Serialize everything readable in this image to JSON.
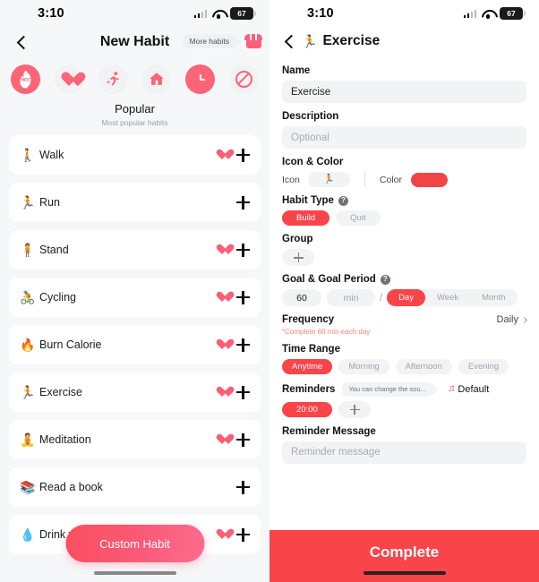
{
  "left": {
    "status": {
      "time": "3:10",
      "battery": "67"
    },
    "nav": {
      "back_icon": "chevron-left-icon",
      "title": "New Habit",
      "tooltip": "More habits",
      "store_icon": "store-icon"
    },
    "categories": [
      {
        "name": "popular",
        "icon": "flame-hot-icon",
        "active": true
      },
      {
        "name": "health",
        "icon": "heart-icon",
        "active": false
      },
      {
        "name": "fitness",
        "icon": "running-icon",
        "glyph": "🏃",
        "active": false
      },
      {
        "name": "home",
        "icon": "house-icon",
        "glyph": "🏠",
        "active": false
      },
      {
        "name": "routine",
        "icon": "clock-icon",
        "active": false
      },
      {
        "name": "quit",
        "icon": "no-entry-icon",
        "active": false
      }
    ],
    "category_title": "Popular",
    "category_subtitle": "Most popular habits",
    "habits": [
      {
        "emoji": "🚶",
        "label": "Walk",
        "favorite": true
      },
      {
        "emoji": "🏃",
        "label": "Run",
        "favorite": false
      },
      {
        "emoji": "🧍",
        "label": "Stand",
        "favorite": true
      },
      {
        "emoji": "🚴",
        "label": "Cycling",
        "favorite": true
      },
      {
        "emoji": "🔥",
        "label": "Burn Calorie",
        "favorite": true
      },
      {
        "emoji": "🏃",
        "label": "Exercise",
        "favorite": true
      },
      {
        "emoji": "🧘",
        "label": "Meditation",
        "favorite": true
      },
      {
        "emoji": "📚",
        "label": "Read a book",
        "favorite": false
      },
      {
        "emoji": "💧",
        "label": "Drink water",
        "favorite": true
      }
    ],
    "custom_habit_button": "Custom Habit"
  },
  "right": {
    "status": {
      "time": "3:10",
      "battery": "67"
    },
    "nav": {
      "back_icon": "chevron-left-icon",
      "emoji": "🏃",
      "title": "Exercise"
    },
    "name": {
      "label": "Name",
      "value": "Exercise"
    },
    "description": {
      "label": "Description",
      "placeholder": "Optional"
    },
    "icon_color": {
      "label": "Icon & Color",
      "icon_label": "Icon",
      "icon_glyph": "🏃",
      "color_label": "Color",
      "color_value": "#f04447"
    },
    "habit_type": {
      "label": "Habit Type",
      "help_icon": "question-mark-icon",
      "options": [
        {
          "label": "Build",
          "selected": true
        },
        {
          "label": "Quit",
          "selected": false
        }
      ]
    },
    "group": {
      "label": "Group",
      "add_icon": "plus-icon"
    },
    "goal": {
      "label": "Goal & Goal Period",
      "help_icon": "question-mark-icon",
      "amount": "60",
      "unit": "min",
      "separator": "/",
      "periods": [
        {
          "label": "Day",
          "selected": true
        },
        {
          "label": "Week",
          "selected": false
        },
        {
          "label": "Month",
          "selected": false
        }
      ]
    },
    "frequency": {
      "label": "Frequency",
      "value": "Daily",
      "note": "*Complete 60 min each day"
    },
    "time_range": {
      "label": "Time Range",
      "options": [
        {
          "label": "Anytime",
          "selected": true
        },
        {
          "label": "Morning",
          "selected": false
        },
        {
          "label": "Afternoon",
          "selected": false
        },
        {
          "label": "Evening",
          "selected": false
        }
      ]
    },
    "reminders": {
      "label": "Reminders",
      "tooltip": "You can change the sou…",
      "sound_icon": "music-note-icon",
      "sound_value": "Default",
      "times": [
        "20:00"
      ],
      "add_icon": "plus-icon"
    },
    "reminder_message": {
      "label": "Reminder Message",
      "placeholder": "Reminder message"
    },
    "complete_button": "Complete"
  }
}
